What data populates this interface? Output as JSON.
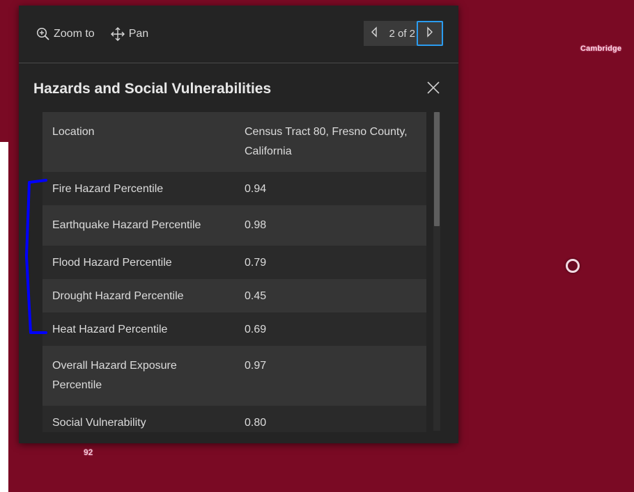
{
  "map": {
    "label_cambridge": "Cambridge",
    "cluster_label": "92"
  },
  "popup": {
    "actions": {
      "zoom_to": "Zoom to",
      "pan": "Pan"
    },
    "pager": {
      "label": "2 of 2"
    },
    "title": "Hazards and Social Vulnerabilities",
    "rows": [
      {
        "key": "Location",
        "value": "Census Tract 80, Fresno County, California"
      },
      {
        "key": "Fire Hazard Percentile",
        "value": "0.94"
      },
      {
        "key": "Earthquake Hazard Percentile",
        "value": "0.98"
      },
      {
        "key": "Flood Hazard Percentile",
        "value": "0.79"
      },
      {
        "key": "Drought Hazard Percentile",
        "value": "0.45"
      },
      {
        "key": "Heat Hazard Percentile",
        "value": "0.69"
      },
      {
        "key": "Overall Hazard Exposure Percentile",
        "value": "0.97"
      },
      {
        "key": "Social Vulnerability",
        "value": "0.80"
      }
    ]
  },
  "colors": {
    "map_background": "#7a0a24",
    "popup_background": "#242424",
    "focus_outline": "#2b9cf0",
    "annotation_bracket": "#0000ff"
  },
  "icons": [
    "zoom-in-icon",
    "pan-move-icon",
    "chevron-left-icon",
    "chevron-right-icon",
    "close-icon"
  ]
}
